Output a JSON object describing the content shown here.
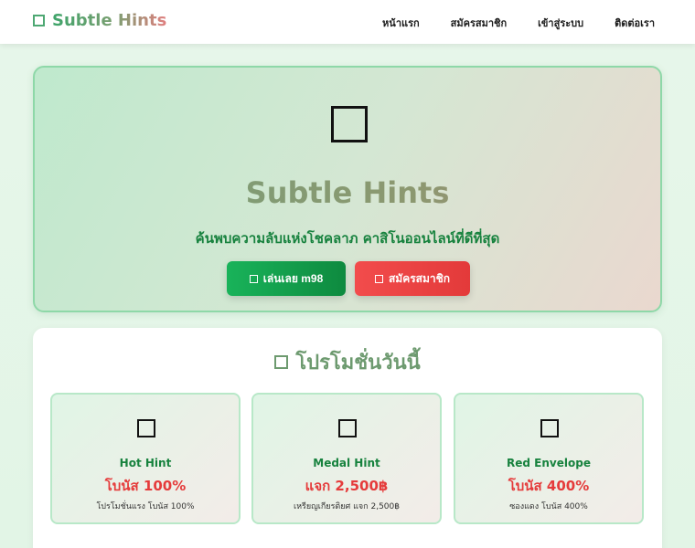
{
  "header": {
    "brand": "Subtle Hints",
    "nav": [
      "หน้าแรก",
      "สมัครสมาชิก",
      "เข้าสู่ระบบ",
      "ติดต่อเรา"
    ]
  },
  "hero": {
    "title": "Subtle Hints",
    "subtitle": "ค้นพบความลับแห่งโชคลาภ คาสิโนออนไลน์ที่ดีที่สุด",
    "play_button": "เล่นเลย m98",
    "signup_button": "สมัครสมาชิก"
  },
  "promotions": {
    "title": "โปรโมชั่นวันนี้",
    "cards": [
      {
        "name": "Hot Hint",
        "bonus": "โบนัส 100%",
        "desc": "โปรโมชั่นแรง โบนัส 100%"
      },
      {
        "name": "Medal Hint",
        "bonus": "แจก 2,500฿",
        "desc": "เหรียญเกียรติยศ แจก 2,500฿"
      },
      {
        "name": "Red Envelope",
        "bonus": "โบนัส 400%",
        "desc": "ซองแดง โบนัส 400%"
      }
    ]
  },
  "colors": {
    "accent_green": "#17823e",
    "accent_red": "#e53b3b",
    "button_green": "#19b35a",
    "button_red": "#f24c4c"
  },
  "icons": {
    "brand": "square-icon",
    "hero": "square-icon",
    "buttons": "square-icon",
    "promotions_title": "square-icon",
    "cards": "square-icon"
  }
}
